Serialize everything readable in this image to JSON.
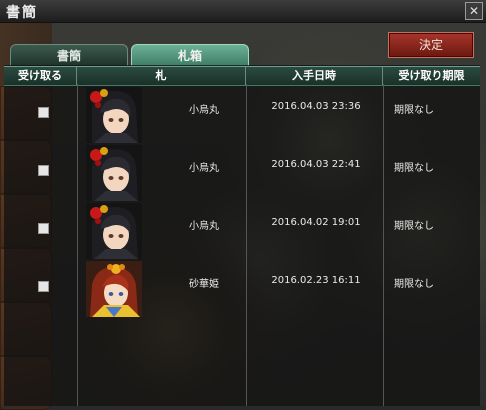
{
  "window": {
    "title": "書簡",
    "close_glyph": "✕"
  },
  "tabs": [
    {
      "label": "書簡",
      "active": false
    },
    {
      "label": "札箱",
      "active": true
    }
  ],
  "confirm_button": "決定",
  "table": {
    "headers": [
      "受け取る",
      "札",
      "入手日時",
      "受け取り期限"
    ],
    "rows": [
      {
        "checked": false,
        "name": "小烏丸",
        "date": "2016.04.03 23:36",
        "limit": "期限なし",
        "portrait": "kogarasumaru"
      },
      {
        "checked": false,
        "name": "小烏丸",
        "date": "2016.04.03 22:41",
        "limit": "期限なし",
        "portrait": "kogarasumaru"
      },
      {
        "checked": false,
        "name": "小烏丸",
        "date": "2016.04.02 19:01",
        "limit": "期限なし",
        "portrait": "kogarasumaru"
      },
      {
        "checked": false,
        "name": "砂華姫",
        "date": "2016.02.23 16:11",
        "limit": "期限なし",
        "portrait": "sakahime"
      }
    ]
  },
  "colors": {
    "header_bg": "#234238",
    "tab_active": "#5a9e86",
    "confirm_red": "#8f2a20"
  }
}
